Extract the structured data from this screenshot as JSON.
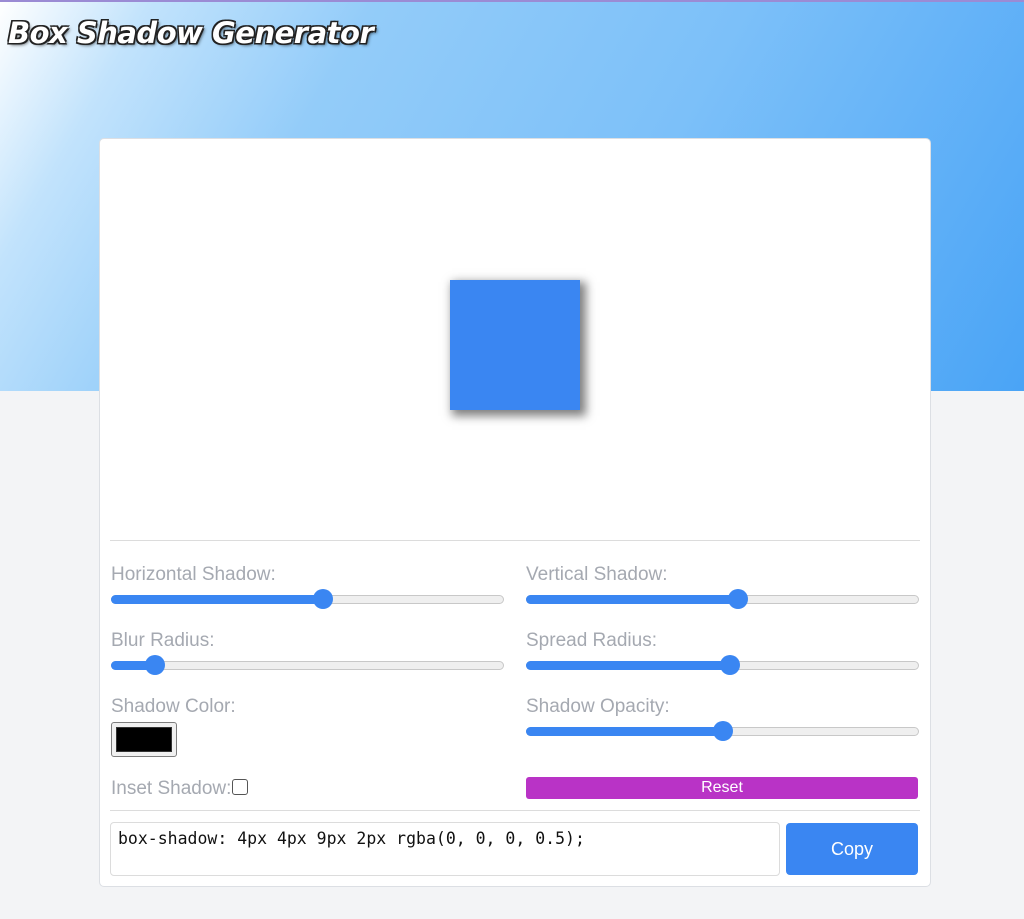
{
  "app": {
    "title": "Box Shadow Generator"
  },
  "controls": {
    "horizontal": {
      "label": "Horizontal Shadow:",
      "value": 4,
      "min": -50,
      "max": 50
    },
    "vertical": {
      "label": "Vertical Shadow:",
      "value": 4,
      "min": -50,
      "max": 50
    },
    "blur": {
      "label": "Blur Radius:",
      "value": 9,
      "min": 0,
      "max": 80
    },
    "spread": {
      "label": "Spread Radius:",
      "value": 2,
      "min": -50,
      "max": 50
    },
    "color": {
      "label": "Shadow Color:",
      "value": "#000000"
    },
    "opacity": {
      "label": "Shadow Opacity:",
      "value": 0.5,
      "min": 0,
      "max": 1
    },
    "inset": {
      "label": "Inset Shadow:",
      "checked": false
    }
  },
  "buttons": {
    "reset_label": "Reset",
    "copy_label": "Copy"
  },
  "output": {
    "css": "box-shadow: 4px 4px 9px 2px rgba(0, 0, 0, 0.5);"
  },
  "colors": {
    "accent": "#3a86f2",
    "reset": "#b933c6",
    "preview_box": "#3a86f2"
  }
}
